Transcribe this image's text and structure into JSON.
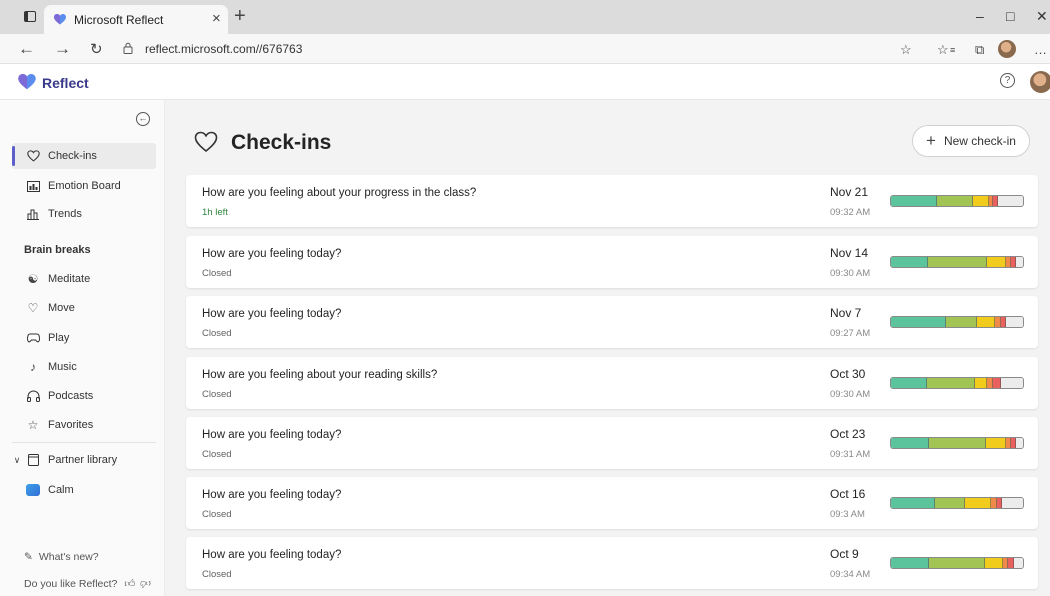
{
  "browser": {
    "tab_title": "Microsoft Reflect",
    "tab_close": "×",
    "new_tab": "+",
    "url": "reflect.microsoft.com//676763",
    "win_min": "–",
    "win_max": "□",
    "win_close": "✕"
  },
  "app": {
    "name": "Reflect",
    "help_glyph": "?",
    "brand_color": "#5b5fc7"
  },
  "sidebar": {
    "collapse_glyph": "←",
    "items_top": [
      {
        "label": "Check-ins",
        "icon": "heart-icon",
        "active": true
      },
      {
        "label": "Emotion Board",
        "icon": "emotion-board-icon"
      },
      {
        "label": "Trends",
        "icon": "trends-icon"
      }
    ],
    "brain_breaks_heading": "Brain breaks",
    "brain_breaks": [
      {
        "label": "Meditate",
        "icon": "meditate-icon"
      },
      {
        "label": "Move",
        "icon": "move-icon"
      },
      {
        "label": "Play",
        "icon": "gamepad-icon"
      },
      {
        "label": "Music",
        "icon": "music-icon"
      },
      {
        "label": "Podcasts",
        "icon": "headphones-icon"
      },
      {
        "label": "Favorites",
        "icon": "star-icon"
      }
    ],
    "partner_library": "Partner library",
    "calm": "Calm",
    "whats_new": "What's new?",
    "feedback": "Do you like Reflect?"
  },
  "main": {
    "title": "Check-ins",
    "new_button": "New check-in",
    "new_button_glyph": "+"
  },
  "emotion_colors": [
    "#5cc49c",
    "#a1c455",
    "#f2cc1c",
    "#f08a4b",
    "#e8615e",
    "#ececec"
  ],
  "checkins": [
    {
      "question": "How are you feeling about your progress in the class?",
      "status": "1h left",
      "open": true,
      "date": "Nov 21",
      "time": "09:32 AM",
      "mix": [
        0.35,
        0.27,
        0.12,
        0.03,
        0.04,
        0.19
      ]
    },
    {
      "question": "How are you feeling today?",
      "status": "Closed",
      "open": false,
      "date": "Nov 14",
      "time": "09:30 AM",
      "mix": [
        0.28,
        0.45,
        0.14,
        0.04,
        0.04,
        0.05
      ]
    },
    {
      "question": "How are you feeling today?",
      "status": "Closed",
      "open": false,
      "date": "Nov 7",
      "time": "09:27 AM",
      "mix": [
        0.42,
        0.23,
        0.14,
        0.04,
        0.04,
        0.13
      ]
    },
    {
      "question": "How are you feeling about your reading skills?",
      "status": "Closed",
      "open": false,
      "date": "Oct 30",
      "time": "09:30 AM",
      "mix": [
        0.27,
        0.37,
        0.09,
        0.04,
        0.06,
        0.17
      ]
    },
    {
      "question": "How are you feeling today?",
      "status": "Closed",
      "open": false,
      "date": "Oct 23",
      "time": "09:31 AM",
      "mix": [
        0.29,
        0.43,
        0.15,
        0.04,
        0.04,
        0.05
      ]
    },
    {
      "question": "How are you feeling today?",
      "status": "Closed",
      "open": false,
      "date": "Oct 16",
      "time": "09:3 AM",
      "mix": [
        0.33,
        0.23,
        0.2,
        0.04,
        0.04,
        0.16
      ]
    },
    {
      "question": "How are you feeling today?",
      "status": "Closed",
      "open": false,
      "date": "Oct 9",
      "time": "09:34 AM",
      "mix": [
        0.29,
        0.42,
        0.14,
        0.04,
        0.04,
        0.07
      ]
    }
  ]
}
